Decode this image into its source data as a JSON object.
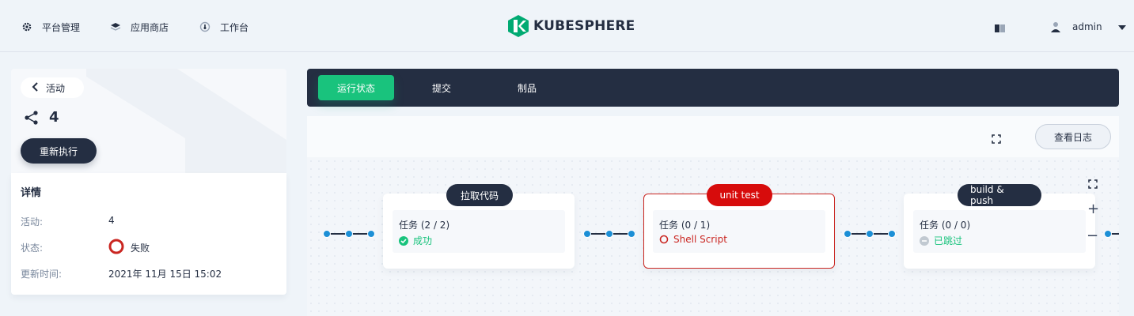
{
  "nav": {
    "platform": "平台管理",
    "appstore": "应用商店",
    "workbench": "工作台",
    "logo_text": "KUBESPHERE",
    "user": "admin"
  },
  "left": {
    "back_label": "活动",
    "run_number": "4",
    "rerun_label": "重新执行",
    "detail_title": "详情",
    "fields": [
      {
        "label": "活动:",
        "value": "4"
      },
      {
        "label": "状态:",
        "value": "失败"
      },
      {
        "label": "更新时间:",
        "value": "2021年 11月 15日 15:02"
      }
    ]
  },
  "tabs": [
    {
      "label": "运行状态",
      "active": true
    },
    {
      "label": "提交",
      "active": false
    },
    {
      "label": "制品",
      "active": false
    }
  ],
  "toolbar": {
    "log_button": "查看日志"
  },
  "stages": [
    {
      "name": "拉取代码",
      "tasks": "任务 (2 / 2)",
      "status": "成功",
      "state": "success"
    },
    {
      "name": "unit test",
      "tasks": "任务 (0 / 1)",
      "status": "Shell Script",
      "state": "failed"
    },
    {
      "name": "build & push",
      "tasks": "任务 (0 / 0)",
      "status": "已跳过",
      "state": "skipped"
    }
  ],
  "controls": {
    "zoom_in": "+",
    "zoom_out": "−"
  },
  "colors": {
    "dark": "#242e42",
    "green": "#19c37d",
    "red": "#d70c0c",
    "connector_dot": "#1c8fd6",
    "skipped": "#c1c9d1"
  }
}
